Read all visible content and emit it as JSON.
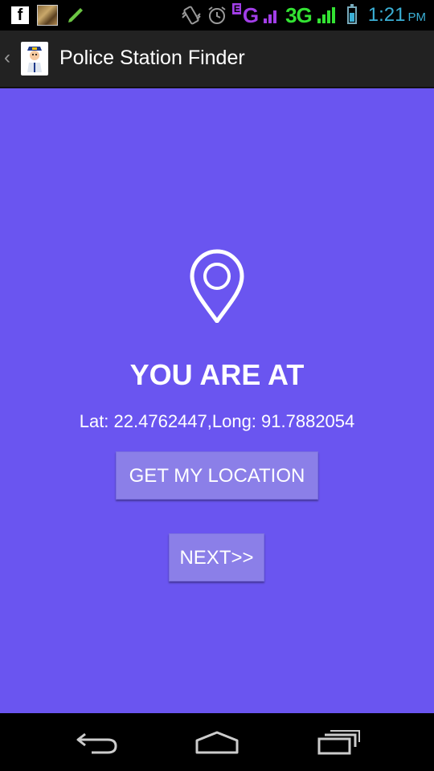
{
  "status_bar": {
    "network_e": "E",
    "network_primary": "G",
    "network_secondary": "3G",
    "time": "1:21",
    "ampm": "PM"
  },
  "action_bar": {
    "title": "Police Station Finder"
  },
  "main": {
    "heading": "YOU ARE AT",
    "coordinates": "Lat: 22.4762447,Long: 91.7882054",
    "get_location_label": "GET MY LOCATION",
    "next_label": "NEXT>>"
  },
  "colors": {
    "background": "#6a55f0",
    "button": "#8b7fe8",
    "action_bar": "#222222"
  }
}
